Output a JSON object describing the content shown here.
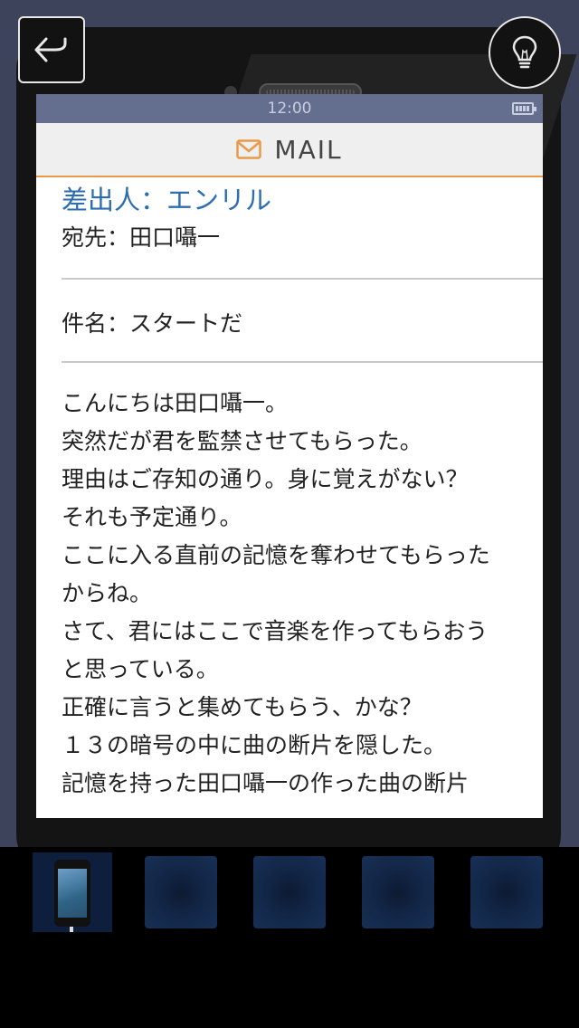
{
  "status_bar": {
    "time": "12:00",
    "battery_icon": "battery-icon"
  },
  "header": {
    "icon": "mail-icon",
    "title": "MAIL"
  },
  "mail": {
    "sender": "差出人：エンリル",
    "recipient": "宛先：田口囁一",
    "subject": "件名：スタートだ",
    "body_lines": [
      "こんにちは田口囁一。",
      "突然だが君を監禁させてもらった。",
      "理由はご存知の通り。身に覚えがない？",
      "それも予定通り。",
      "ここに入る直前の記憶を奪わせてもらった",
      "からね。",
      "さて、君にはここで音楽を作ってもらおう",
      "と思っている。",
      "正確に言うと集めてもらう、かな？",
      "１３の暗号の中に曲の断片を隠した。",
      "記憶を持った田口囁一の作った曲の断片"
    ]
  },
  "controls": {
    "back_icon": "back-arrow-icon",
    "hint_icon": "lightbulb-icon"
  },
  "inventory": {
    "slots": [
      "phone",
      "empty",
      "empty",
      "empty",
      "empty"
    ],
    "selected_index": 0
  },
  "colors": {
    "accent_orange": "#e89a4a",
    "sender_blue": "#2e6db0",
    "status_bar": "#646e8e"
  }
}
